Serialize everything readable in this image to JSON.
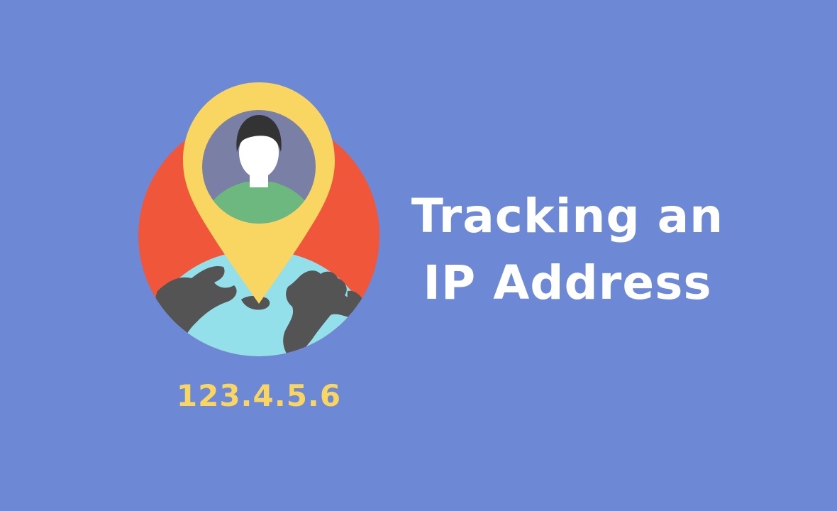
{
  "headline": {
    "line1": "Tracking an",
    "line2": "IP Address"
  },
  "ip_address": "123.4.5.6",
  "illustration": {
    "icon": "location-pin-globe-user-icon"
  },
  "colors": {
    "background": "#6d89d6",
    "headline_text": "#ffffff",
    "ip_text": "#f9d561",
    "circle": "#f0573a",
    "pin": "#f9d561",
    "avatar_bg": "#7a7fa6",
    "ocean": "#93dfea",
    "land": "#545454",
    "shirt": "#6cb87f",
    "hair": "#333333",
    "face": "#ffffff"
  }
}
